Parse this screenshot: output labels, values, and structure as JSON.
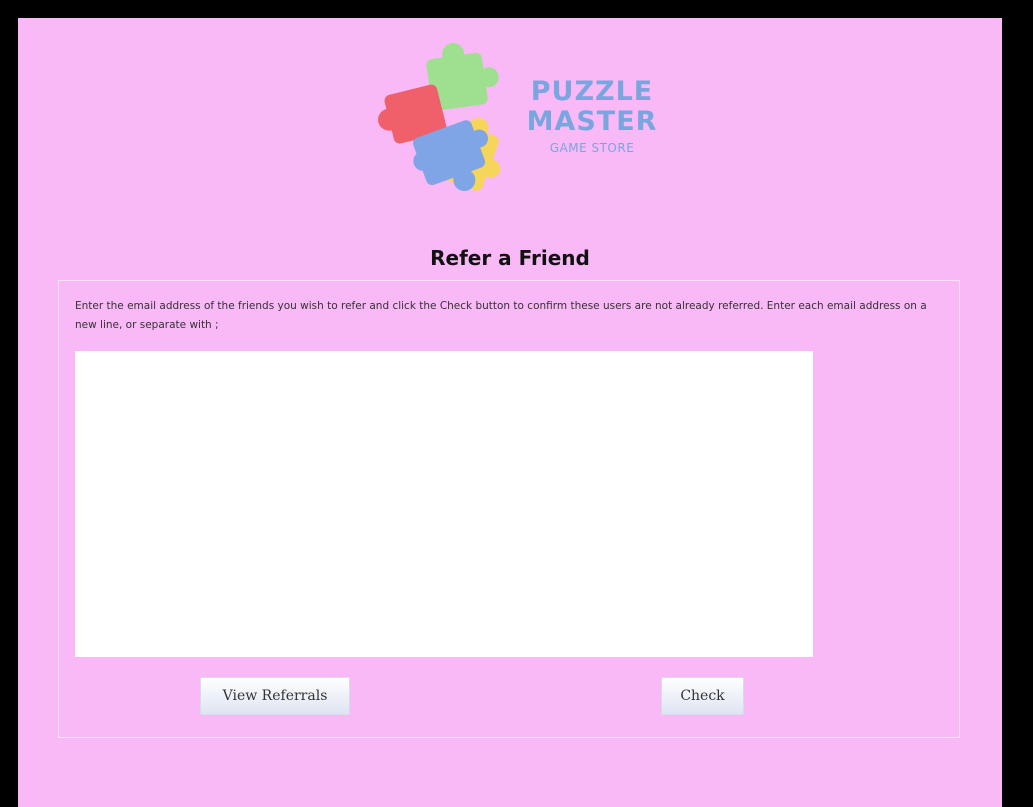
{
  "logo": {
    "line1": "PUZZLE",
    "line2": "MASTER",
    "line3": "GAME STORE",
    "icon": "puzzle-pieces-icon",
    "colors": {
      "red": "#f0606a",
      "green": "#9ee08f",
      "yellow": "#f5d55a",
      "blue": "#7fa5e6",
      "text": "#7aa6df"
    }
  },
  "page": {
    "title": "Refer a Friend",
    "background": "#f9b8f6"
  },
  "form": {
    "instructions": "Enter the email address of the friends you wish to refer and click the Check button to confirm these users are not already referred. Enter each email address on a new line, or separate with ;",
    "emails_value": "",
    "view_referrals_label": "View Referrals",
    "check_label": "Check"
  }
}
